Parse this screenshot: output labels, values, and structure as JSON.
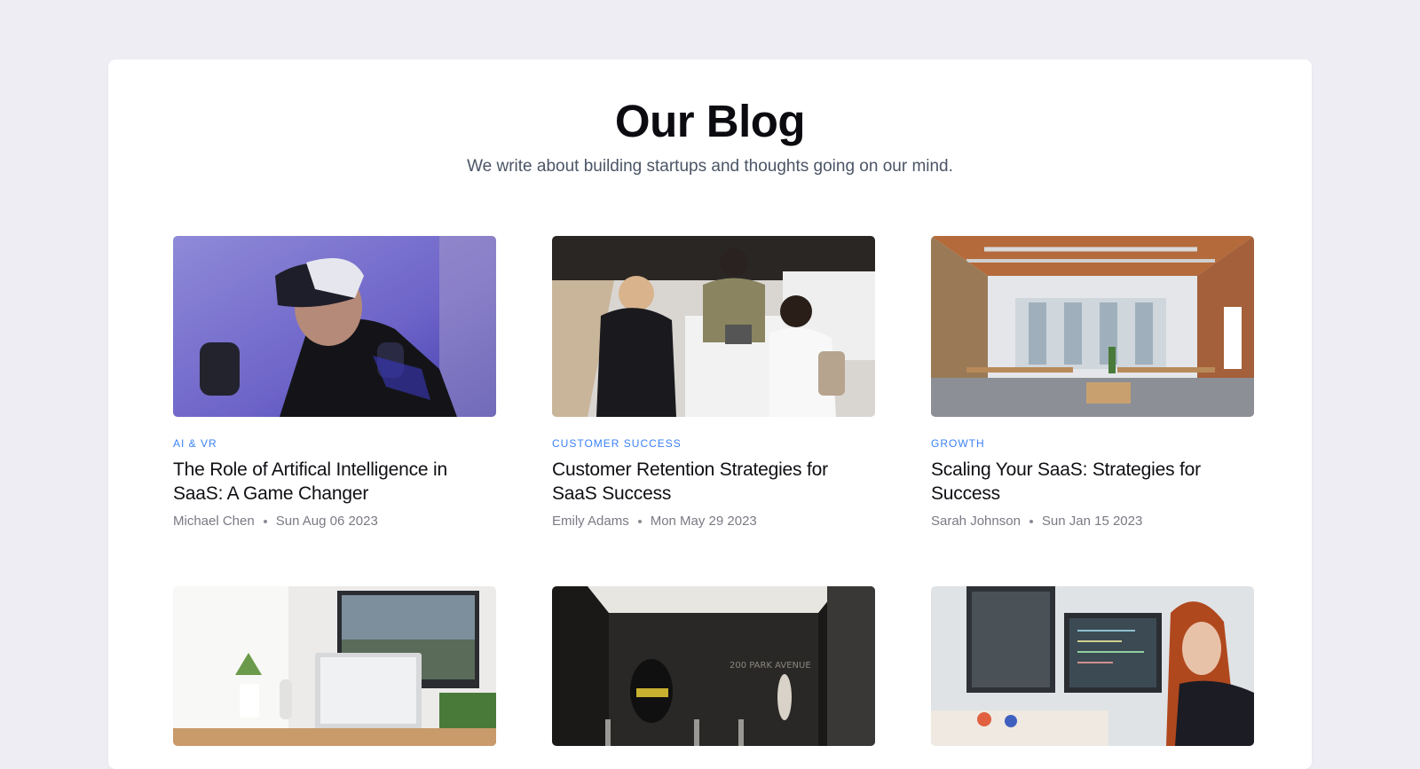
{
  "blog": {
    "title": "Our Blog",
    "subtitle": "We write about building startups and thoughts going on our mind."
  },
  "posts": [
    {
      "category": "AI & VR",
      "title": "The Role of Artifical Intelligence in SaaS: A Game Changer",
      "author": "Michael Chen",
      "date": "Sun Aug 06 2023",
      "image": "vr-headset-photo"
    },
    {
      "category": "CUSTOMER SUCCESS",
      "title": "Customer Retention Strategies for SaaS Success",
      "author": "Emily Adams",
      "date": "Mon May 29 2023",
      "image": "coffee-shop-counter-photo"
    },
    {
      "category": "GROWTH",
      "title": "Scaling Your SaaS: Strategies for Success",
      "author": "Sarah Johnson",
      "date": "Sun Jan 15 2023",
      "image": "open-office-photo"
    },
    {
      "image": "laptop-desk-photo"
    },
    {
      "image": "building-lobby-photo",
      "sign": "200 PARK AVENUE"
    },
    {
      "image": "developer-monitors-photo"
    }
  ],
  "colors": {
    "background": "#eeedf4",
    "card": "#ffffff",
    "category": "#3b82f6",
    "title": "#0f0f14",
    "meta": "#7a7a84"
  }
}
